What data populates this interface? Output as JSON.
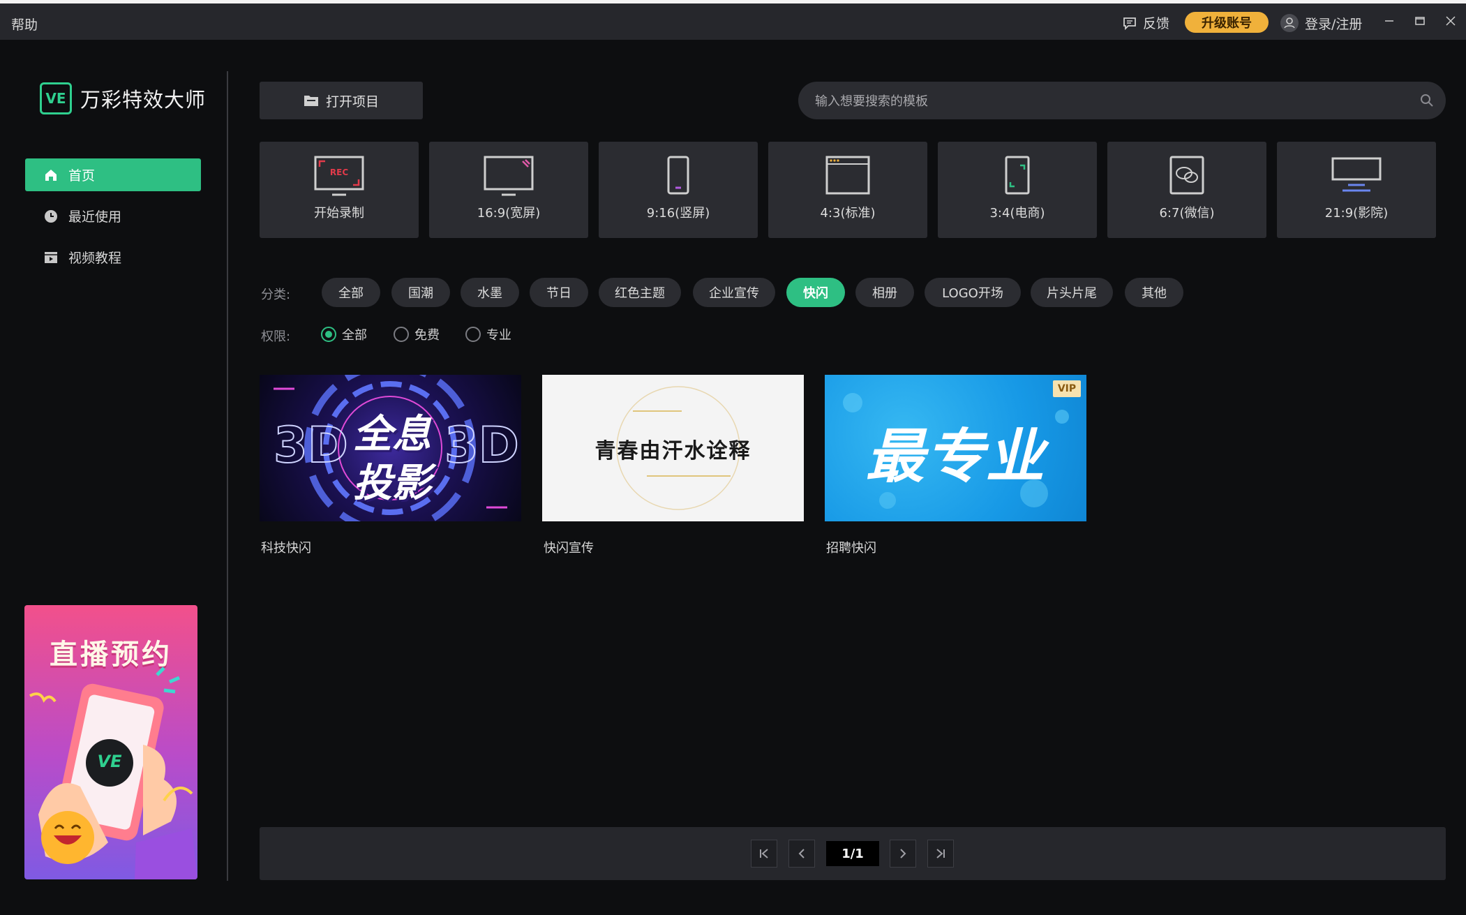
{
  "titlebar": {
    "help": "帮助",
    "feedback": "反馈",
    "upgrade": "升级账号",
    "login": "登录/注册"
  },
  "sidebar": {
    "logo_mark": "VE",
    "app_name": "万彩特效大师",
    "items": [
      {
        "label": "首页",
        "icon": "home-icon",
        "active": true
      },
      {
        "label": "最近使用",
        "icon": "clock-icon",
        "active": false
      },
      {
        "label": "视频教程",
        "icon": "video-icon",
        "active": false
      }
    ],
    "promo": {
      "title": "直播预约",
      "mark": "VE"
    }
  },
  "toolbar": {
    "open_project": "打开项目",
    "search_placeholder": "输入想要搜索的模板"
  },
  "ratios": [
    {
      "label": "开始录制",
      "icon": "record-icon",
      "badge": "REC"
    },
    {
      "label": "16:9(宽屏)",
      "icon": "widescreen-icon"
    },
    {
      "label": "9:16(竖屏)",
      "icon": "portrait-icon"
    },
    {
      "label": "4:3(标准)",
      "icon": "standard-icon"
    },
    {
      "label": "3:4(电商)",
      "icon": "ecommerce-icon"
    },
    {
      "label": "6:7(微信)",
      "icon": "wechat-icon"
    },
    {
      "label": "21:9(影院)",
      "icon": "cinema-icon"
    }
  ],
  "categories": {
    "label": "分类:",
    "items": [
      "全部",
      "国潮",
      "水墨",
      "节日",
      "红色主题",
      "企业宣传",
      "快闪",
      "相册",
      "LOGO开场",
      "片头片尾",
      "其他"
    ],
    "active": "快闪"
  },
  "permissions": {
    "label": "权限:",
    "options": [
      "全部",
      "免费",
      "专业"
    ],
    "selected": "全部"
  },
  "templates": [
    {
      "name": "科技快闪",
      "thumb_line1": "全息",
      "thumb_line2": "投影",
      "thumb_side": "3D"
    },
    {
      "name": "快闪宣传",
      "thumb_text": "青春由汗水诠释"
    },
    {
      "name": "招聘快闪",
      "thumb_text": "最专业",
      "badge": "VIP"
    }
  ],
  "pagination": {
    "page": "1/1"
  },
  "colors": {
    "accent": "#2ebf83",
    "upgrade": "#f0b13b",
    "card": "#2b2c31"
  }
}
